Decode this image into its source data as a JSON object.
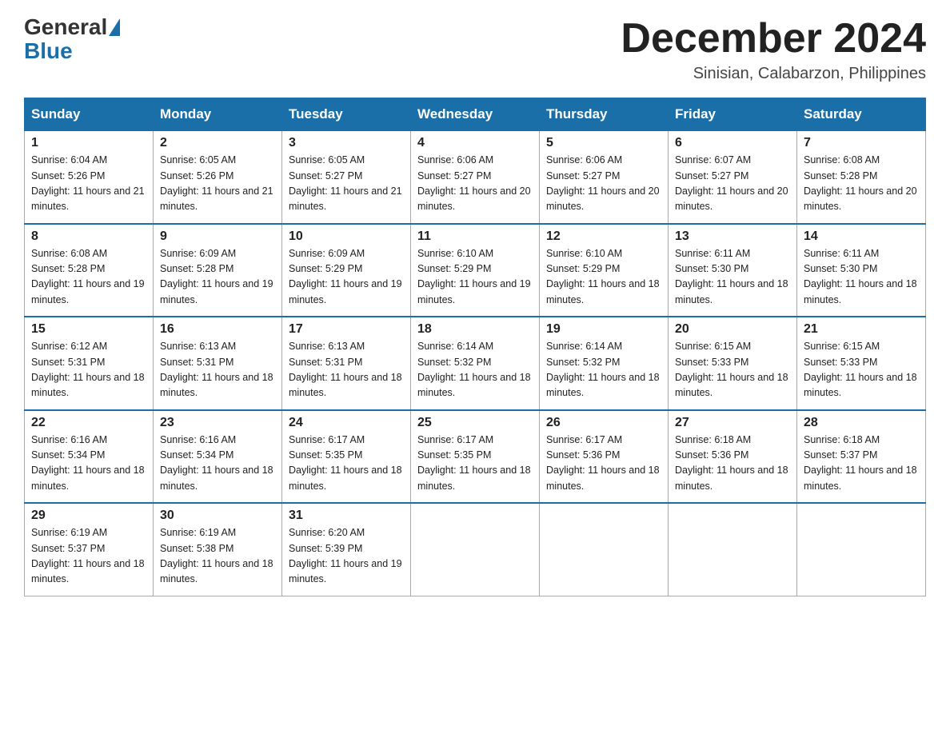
{
  "header": {
    "logo_general": "General",
    "logo_blue": "Blue",
    "month_year": "December 2024",
    "location": "Sinisian, Calabarzon, Philippines"
  },
  "days_of_week": [
    "Sunday",
    "Monday",
    "Tuesday",
    "Wednesday",
    "Thursday",
    "Friday",
    "Saturday"
  ],
  "weeks": [
    [
      {
        "day": "1",
        "sunrise": "6:04 AM",
        "sunset": "5:26 PM",
        "daylight": "11 hours and 21 minutes."
      },
      {
        "day": "2",
        "sunrise": "6:05 AM",
        "sunset": "5:26 PM",
        "daylight": "11 hours and 21 minutes."
      },
      {
        "day": "3",
        "sunrise": "6:05 AM",
        "sunset": "5:27 PM",
        "daylight": "11 hours and 21 minutes."
      },
      {
        "day": "4",
        "sunrise": "6:06 AM",
        "sunset": "5:27 PM",
        "daylight": "11 hours and 20 minutes."
      },
      {
        "day": "5",
        "sunrise": "6:06 AM",
        "sunset": "5:27 PM",
        "daylight": "11 hours and 20 minutes."
      },
      {
        "day": "6",
        "sunrise": "6:07 AM",
        "sunset": "5:27 PM",
        "daylight": "11 hours and 20 minutes."
      },
      {
        "day": "7",
        "sunrise": "6:08 AM",
        "sunset": "5:28 PM",
        "daylight": "11 hours and 20 minutes."
      }
    ],
    [
      {
        "day": "8",
        "sunrise": "6:08 AM",
        "sunset": "5:28 PM",
        "daylight": "11 hours and 19 minutes."
      },
      {
        "day": "9",
        "sunrise": "6:09 AM",
        "sunset": "5:28 PM",
        "daylight": "11 hours and 19 minutes."
      },
      {
        "day": "10",
        "sunrise": "6:09 AM",
        "sunset": "5:29 PM",
        "daylight": "11 hours and 19 minutes."
      },
      {
        "day": "11",
        "sunrise": "6:10 AM",
        "sunset": "5:29 PM",
        "daylight": "11 hours and 19 minutes."
      },
      {
        "day": "12",
        "sunrise": "6:10 AM",
        "sunset": "5:29 PM",
        "daylight": "11 hours and 18 minutes."
      },
      {
        "day": "13",
        "sunrise": "6:11 AM",
        "sunset": "5:30 PM",
        "daylight": "11 hours and 18 minutes."
      },
      {
        "day": "14",
        "sunrise": "6:11 AM",
        "sunset": "5:30 PM",
        "daylight": "11 hours and 18 minutes."
      }
    ],
    [
      {
        "day": "15",
        "sunrise": "6:12 AM",
        "sunset": "5:31 PM",
        "daylight": "11 hours and 18 minutes."
      },
      {
        "day": "16",
        "sunrise": "6:13 AM",
        "sunset": "5:31 PM",
        "daylight": "11 hours and 18 minutes."
      },
      {
        "day": "17",
        "sunrise": "6:13 AM",
        "sunset": "5:31 PM",
        "daylight": "11 hours and 18 minutes."
      },
      {
        "day": "18",
        "sunrise": "6:14 AM",
        "sunset": "5:32 PM",
        "daylight": "11 hours and 18 minutes."
      },
      {
        "day": "19",
        "sunrise": "6:14 AM",
        "sunset": "5:32 PM",
        "daylight": "11 hours and 18 minutes."
      },
      {
        "day": "20",
        "sunrise": "6:15 AM",
        "sunset": "5:33 PM",
        "daylight": "11 hours and 18 minutes."
      },
      {
        "day": "21",
        "sunrise": "6:15 AM",
        "sunset": "5:33 PM",
        "daylight": "11 hours and 18 minutes."
      }
    ],
    [
      {
        "day": "22",
        "sunrise": "6:16 AM",
        "sunset": "5:34 PM",
        "daylight": "11 hours and 18 minutes."
      },
      {
        "day": "23",
        "sunrise": "6:16 AM",
        "sunset": "5:34 PM",
        "daylight": "11 hours and 18 minutes."
      },
      {
        "day": "24",
        "sunrise": "6:17 AM",
        "sunset": "5:35 PM",
        "daylight": "11 hours and 18 minutes."
      },
      {
        "day": "25",
        "sunrise": "6:17 AM",
        "sunset": "5:35 PM",
        "daylight": "11 hours and 18 minutes."
      },
      {
        "day": "26",
        "sunrise": "6:17 AM",
        "sunset": "5:36 PM",
        "daylight": "11 hours and 18 minutes."
      },
      {
        "day": "27",
        "sunrise": "6:18 AM",
        "sunset": "5:36 PM",
        "daylight": "11 hours and 18 minutes."
      },
      {
        "day": "28",
        "sunrise": "6:18 AM",
        "sunset": "5:37 PM",
        "daylight": "11 hours and 18 minutes."
      }
    ],
    [
      {
        "day": "29",
        "sunrise": "6:19 AM",
        "sunset": "5:37 PM",
        "daylight": "11 hours and 18 minutes."
      },
      {
        "day": "30",
        "sunrise": "6:19 AM",
        "sunset": "5:38 PM",
        "daylight": "11 hours and 18 minutes."
      },
      {
        "day": "31",
        "sunrise": "6:20 AM",
        "sunset": "5:39 PM",
        "daylight": "11 hours and 19 minutes."
      },
      null,
      null,
      null,
      null
    ]
  ]
}
